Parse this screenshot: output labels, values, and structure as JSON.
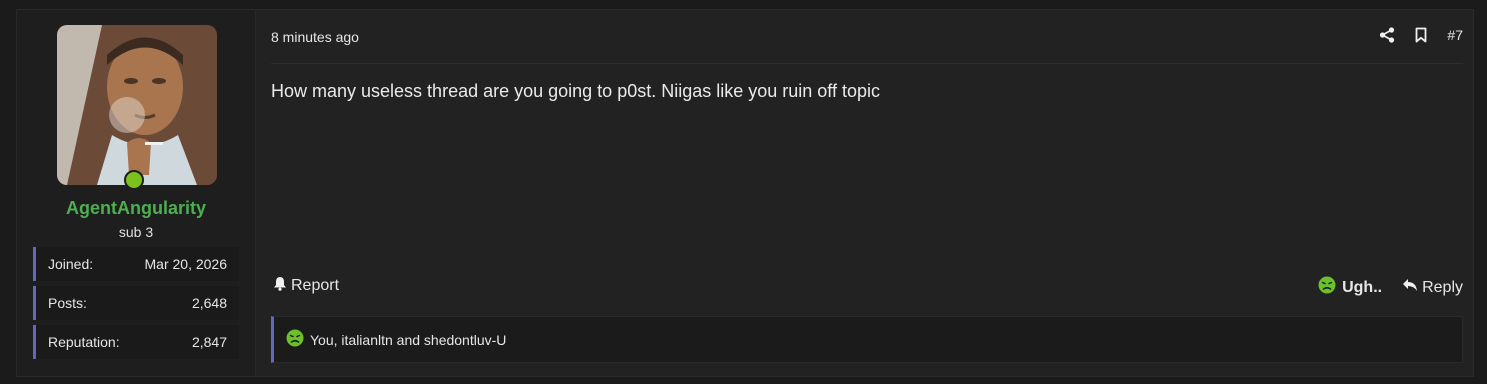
{
  "user": {
    "name": "AgentAngularity",
    "title": "sub 3",
    "online": true,
    "stats": [
      {
        "key": "Joined:",
        "value": "Mar 20, 2026"
      },
      {
        "key": "Posts:",
        "value": "2,648"
      },
      {
        "key": "Reputation:",
        "value": "2,847"
      }
    ]
  },
  "post": {
    "time": "8 minutes ago",
    "number": "#7",
    "body": "How many useless thread are you going to p0st. Niigas like you ruin off topic"
  },
  "actions": {
    "report_label": "Report",
    "reaction_label": "Ugh..",
    "reply_label": "Reply"
  },
  "reactions": {
    "summary": "You, italianltn and shedontluv-U"
  },
  "colors": {
    "accent": "#5c6bc0",
    "username": "#4caf50",
    "online": "#7bc21c",
    "reaction": "#6cc02a"
  }
}
